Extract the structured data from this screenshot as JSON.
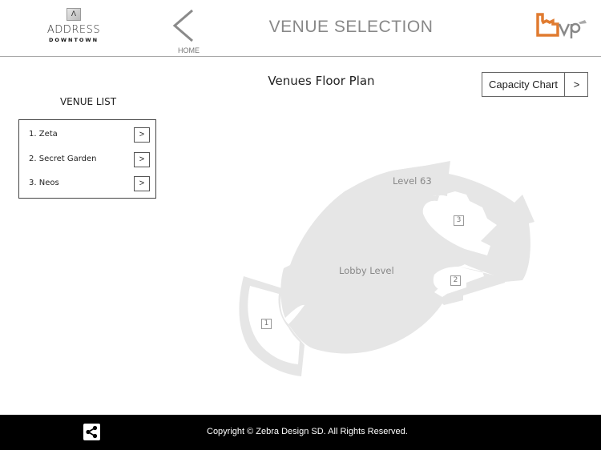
{
  "header": {
    "brand_top": "ADDRESS",
    "brand_bottom": "DOWNTOWN",
    "brand_mark": "Λ",
    "home_label": "HOME",
    "title": "VENUE SELECTION",
    "partner_logo": "bvp"
  },
  "venue_list": {
    "title": "VENUE LIST",
    "items": [
      {
        "label": "1. Zeta",
        "action": ">"
      },
      {
        "label": "2. Secret Garden",
        "action": ">"
      },
      {
        "label": "3. Neos",
        "action": ">"
      }
    ]
  },
  "floor_plan": {
    "title": "Venues Floor Plan",
    "capacity_button": "Capacity Chart",
    "capacity_arrow": ">",
    "labels": {
      "level63": "Level 63",
      "lobby": "Lobby Level"
    },
    "markers": [
      "1",
      "2",
      "3"
    ],
    "fill_color": "#e6e6e6"
  },
  "footer": {
    "copyright": "Copyright © Zebra Design SD. All Rights Reserved.",
    "share_icon": "share-icon"
  }
}
